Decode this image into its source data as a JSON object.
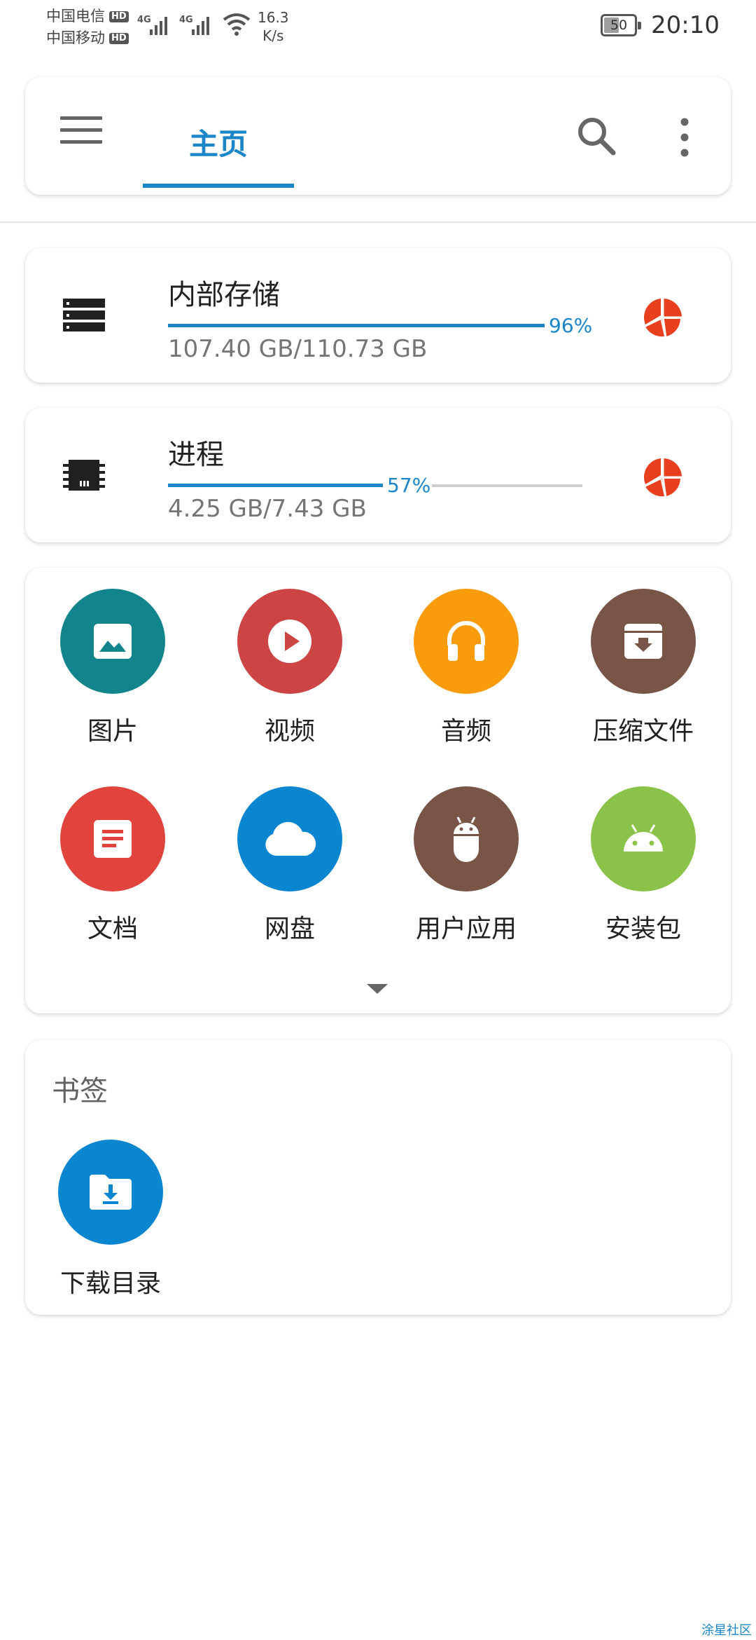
{
  "status_bar": {
    "carrier1": "中国电信",
    "carrier2": "中国移动",
    "hd_badge": "HD",
    "network_type": "4G",
    "net_speed_value": "16.3",
    "net_speed_unit": "K/s",
    "battery_level": "50",
    "time": "20:10"
  },
  "toolbar": {
    "tab_home": "主页"
  },
  "storage": [
    {
      "title": "内部存储",
      "percent_label": "96%",
      "percent": 96,
      "usage": "107.40 GB/110.73 GB"
    },
    {
      "title": "进程",
      "percent_label": "57%",
      "percent": 57,
      "usage": "4.25 GB/7.43 GB"
    }
  ],
  "categories": [
    {
      "label": "图片",
      "icon": "image-icon",
      "color": "#12858c"
    },
    {
      "label": "视频",
      "icon": "play-icon",
      "color": "#cc4444"
    },
    {
      "label": "音频",
      "icon": "headphones-icon",
      "color": "#f99b0b"
    },
    {
      "label": "压缩文件",
      "icon": "archive-icon",
      "color": "#795548"
    },
    {
      "label": "文档",
      "icon": "document-icon",
      "color": "#e0443c"
    },
    {
      "label": "网盘",
      "icon": "cloud-icon",
      "color": "#0a85d0"
    },
    {
      "label": "用户应用",
      "icon": "android-app-icon",
      "color": "#795548"
    },
    {
      "label": "安装包",
      "icon": "android-icon",
      "color": "#8bc34a"
    }
  ],
  "bookmarks": {
    "title": "书签",
    "items": [
      {
        "label": "下载目录",
        "icon": "download-folder-icon",
        "color": "#0a85d0"
      }
    ]
  },
  "colors": {
    "accent": "#1a86c7",
    "pie": "#e8401e"
  },
  "watermark": "涂星社区"
}
